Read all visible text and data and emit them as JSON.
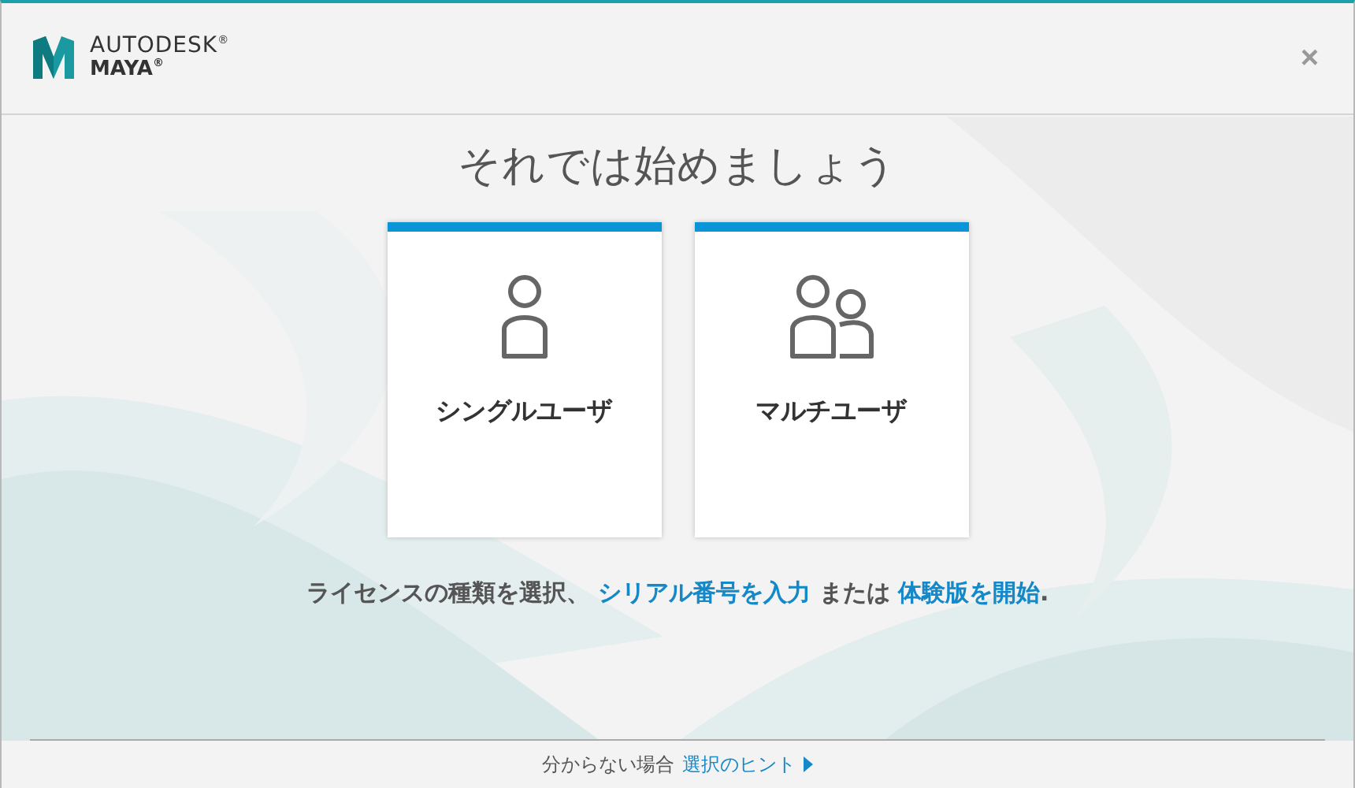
{
  "header": {
    "brand": "AUTODESK$^{®}$",
    "product": "MAYA$^{®}$",
    "close": "×"
  },
  "title": "それでは始めましょう",
  "options": [
    {
      "kind": "single",
      "label": "シングルユーザ"
    },
    {
      "kind": "multi",
      "label": "マルチユーザ"
    }
  ],
  "instruction": [
    {
      "kind": "text",
      "text": "ライセンスの種類を選択、"
    },
    {
      "kind": "link",
      "text": "シリアル番号を入力"
    },
    {
      "kind": "text",
      "text": "または"
    },
    {
      "kind": "link",
      "text": "体験版を開始"
    },
    {
      "kind": "text",
      "text": "."
    }
  ],
  "footer": {
    "text": "分からない場合",
    "link": "選択のヒント"
  }
}
